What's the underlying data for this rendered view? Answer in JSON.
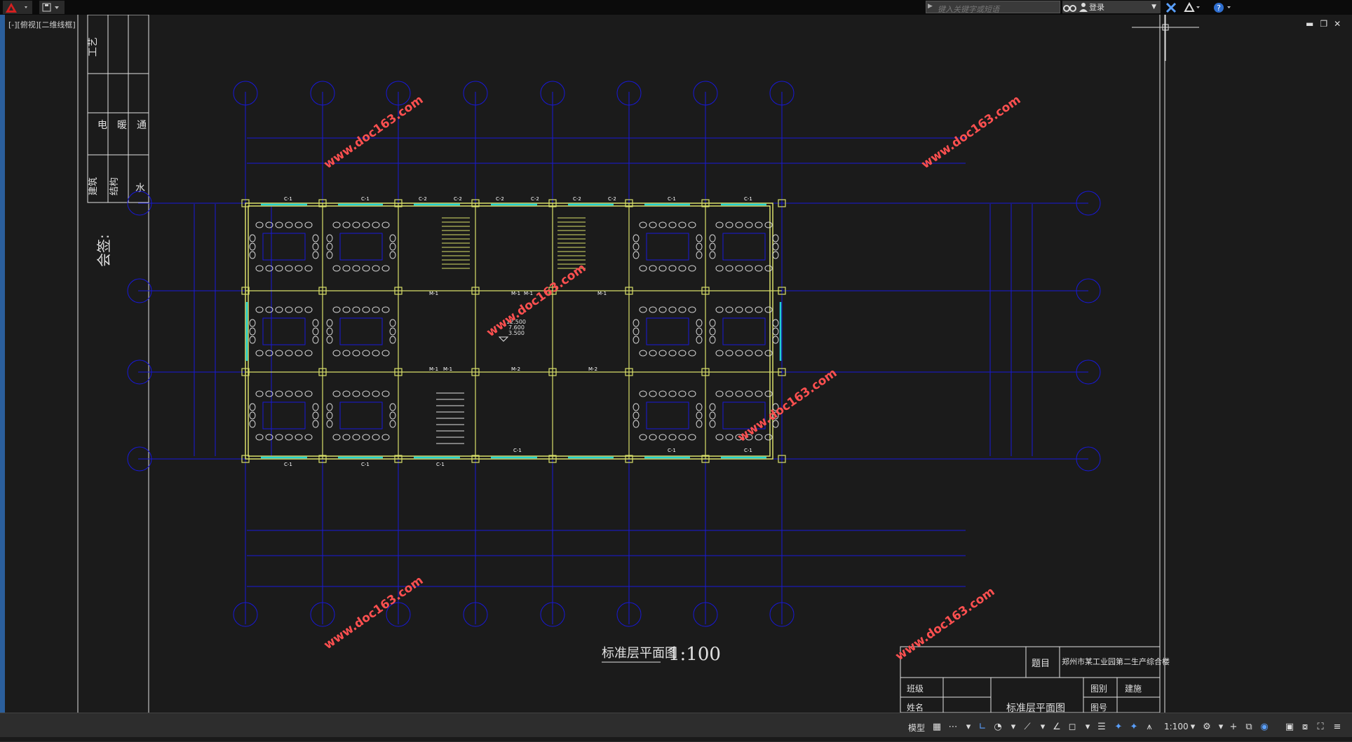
{
  "app": {
    "tab_label": "[-][俯视][二维线框]",
    "search_placeholder": "键入关键字或短语",
    "signin_label": "登录"
  },
  "sheet": {
    "discipline_header": "工艺",
    "discipline_1": "电",
    "discipline_2": "暖",
    "discipline_3": "通",
    "discipline_4": "建筑",
    "discipline_5": "结构",
    "discipline_6": "水",
    "countersign": "会签:"
  },
  "plan": {
    "title": "标准层平面图",
    "scale": "1:100",
    "watermark": "www.doc163.com",
    "elevation_1": "12.500",
    "elevation_2": "7.600",
    "elevation_3": "3.500",
    "window_labels": [
      "C-1",
      "C-2",
      "M-1",
      "M-2"
    ]
  },
  "title_block": {
    "subject_label": "题目",
    "subject_value": "郑州市某工业园第二生产综合楼",
    "class_label": "班级",
    "name_label": "姓名",
    "drawing_name": "标准层平面图",
    "category_label": "图别",
    "category_value": "建施",
    "number_label": "图号"
  },
  "statusbar": {
    "model_label": "模型",
    "scale_label": "1:100"
  },
  "colors": {
    "grid_blue": "#1818d8",
    "wall_yellow": "#d9e06a",
    "window_cyan": "#22d0d0",
    "watermark_red": "#ff5050",
    "frame_white": "#e0e0e0"
  }
}
